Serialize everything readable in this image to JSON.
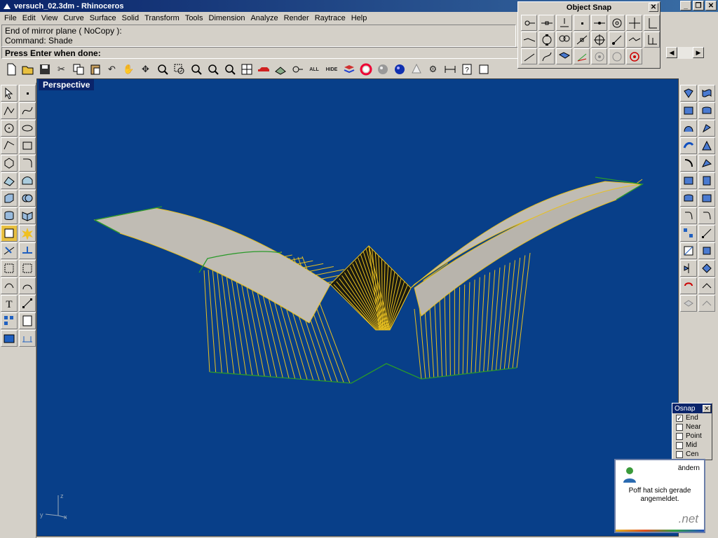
{
  "window": {
    "title": "versuch_02.3dm - Rhinoceros"
  },
  "menu": [
    "File",
    "Edit",
    "View",
    "Curve",
    "Surface",
    "Solid",
    "Transform",
    "Tools",
    "Dimension",
    "Analyze",
    "Render",
    "Raytrace",
    "Help"
  ],
  "command_history": [
    "End of mirror plane ( NoCopy ):",
    "Command: Shade"
  ],
  "command_prompt": "Press Enter when done:",
  "toolbar": {
    "all_label": "ALL",
    "hide_label": "HIDE"
  },
  "viewport": {
    "label": "Perspective",
    "background": "#083f89",
    "axis_labels": {
      "z": "z",
      "y": "y",
      "x": "x"
    }
  },
  "object_snap_panel": {
    "title": "Object Snap",
    "close": "✕"
  },
  "osnap_panel": {
    "title": "Osnap",
    "close": "✕",
    "items": [
      {
        "label": "End",
        "checked": true
      },
      {
        "label": "Near",
        "checked": false
      },
      {
        "label": "Point",
        "checked": false
      },
      {
        "label": "Mid",
        "checked": false
      },
      {
        "label": "Cen",
        "checked": false
      }
    ]
  },
  "notification": {
    "link": "ändern",
    "message_line1": "Poff hat sich gerade",
    "message_line2": "angemeldet.",
    "brand": ".net"
  }
}
